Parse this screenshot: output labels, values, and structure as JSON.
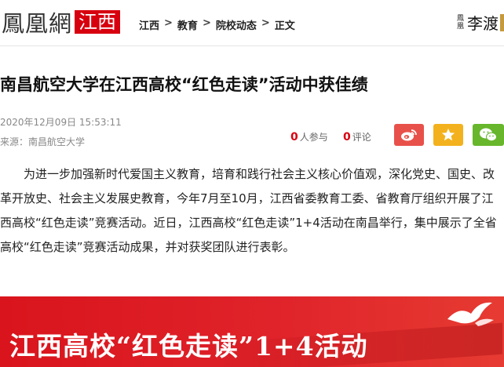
{
  "colors": {
    "brand_red": "#d7000f",
    "weibo": "#e8514a",
    "favorite": "#f3b21d",
    "wechat": "#67b62b",
    "banner_red": "#e0232a"
  },
  "header": {
    "logo_text": "鳳凰網",
    "logo_region": "江西",
    "breadcrumb": [
      "江西",
      "教育",
      "院校动态",
      "正文"
    ],
    "breadcrumb_separator": ">",
    "promo_small": "鳳凰",
    "promo_big": "李渡"
  },
  "article": {
    "title": "南昌航空大学在江西高校“红色走读”活动中获佳绩",
    "datetime": "2020年12月09日 15:53:11",
    "source": "来源：南昌航空大学",
    "participants_count": "0",
    "participants_label": "人参与",
    "comments_count": "0",
    "comments_label": "评论",
    "share_icons": [
      "weibo-icon",
      "star-icon",
      "wechat-icon"
    ],
    "body": "为进一步加强新时代爱国主义教育，培育和践行社会主义核心价值观，深化党史、国史、改革开放史、社会主义发展史教育，今年7月至10月，江西省委教育工委、省教育厅组织开展了江西高校“红色走读”竞赛活动。近日，江西高校“红色走读”1+4活动在南昌举行，集中展示了全省高校“红色走读”竞赛活动成果，并对获奖团队进行表彰。",
    "banner_text": "江西高校“红色走读”1+4活动"
  }
}
